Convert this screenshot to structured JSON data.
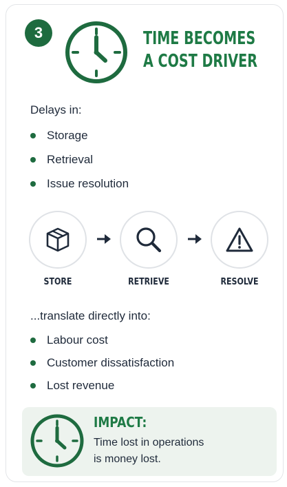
{
  "badge": {
    "number": "3"
  },
  "title": {
    "line1": "TIME BECOMES",
    "line2": "A COST DRIVER"
  },
  "delays": {
    "heading": "Delays in:",
    "items": [
      "Storage",
      "Retrieval",
      "Issue resolution"
    ]
  },
  "steps": [
    {
      "label": "STORE",
      "icon": "box-icon"
    },
    {
      "label": "RETRIEVE",
      "icon": "magnifier-icon"
    },
    {
      "label": "RESOLVE",
      "icon": "warning-icon"
    }
  ],
  "translate": {
    "heading": "...translate directly into:",
    "items": [
      "Labour cost",
      "Customer dissatisfaction",
      "Lost revenue"
    ]
  },
  "impact": {
    "title": "IMPACT:",
    "line1": "Time lost in operations",
    "line2": "is money lost."
  },
  "colors": {
    "accent_green": "#1e7a45",
    "badge_green": "#1e6b3f",
    "impact_bg": "#edf3ee",
    "text_dark": "#1f2a3a"
  }
}
